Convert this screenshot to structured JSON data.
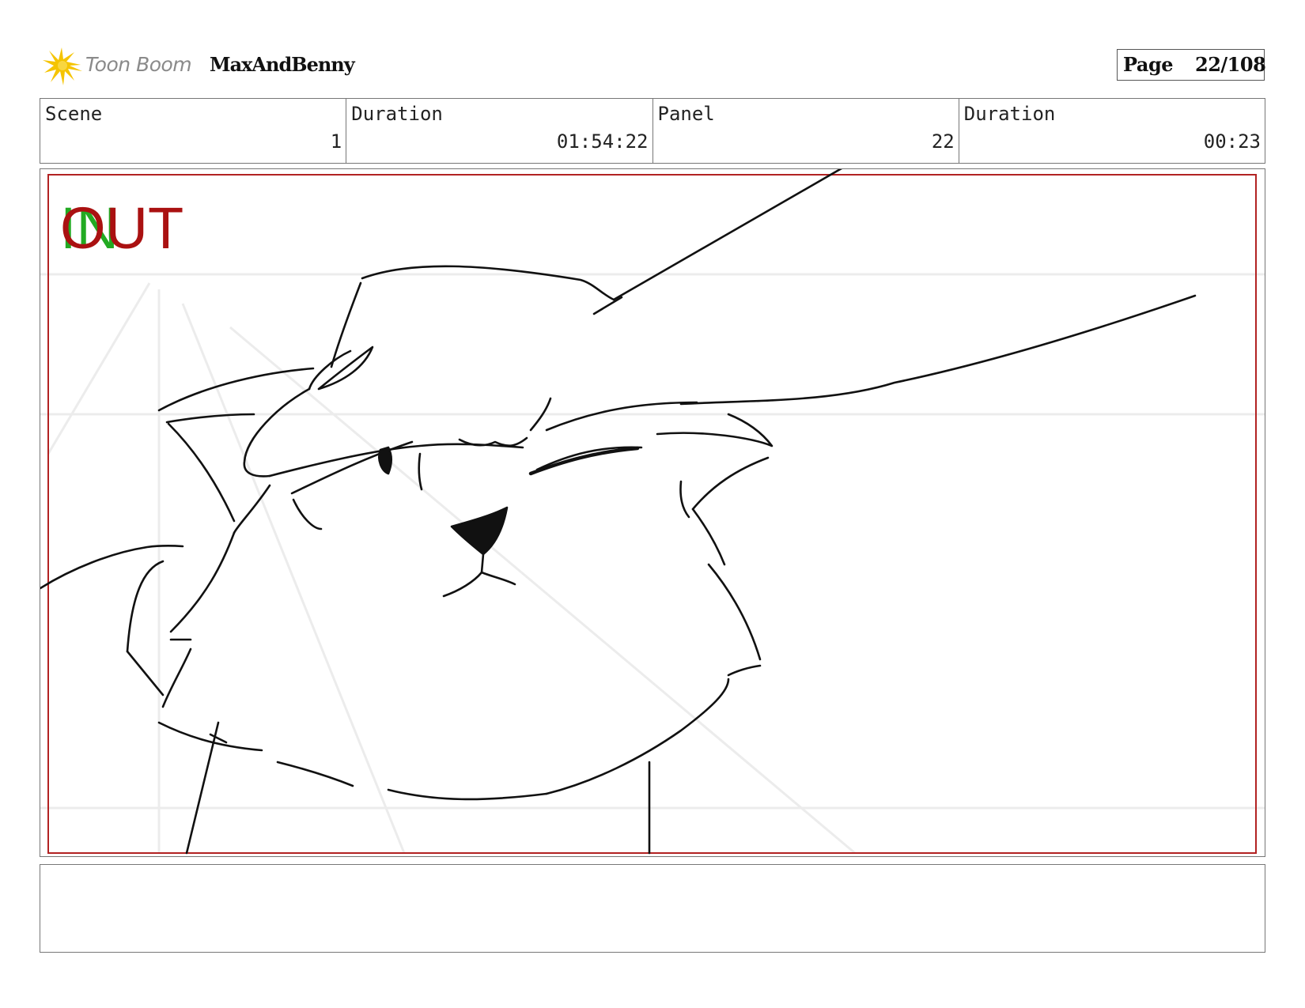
{
  "header": {
    "brand": "Toon Boom",
    "project": "MaxAndBenny",
    "page_label": "Page",
    "page_number": "22/108",
    "logo_icon": "starburst-logo-icon",
    "logo_color": "#f5c400"
  },
  "info": {
    "scene_label": "Scene",
    "scene_value": "1",
    "scene_duration_label": "Duration",
    "scene_duration_value": "01:54:22",
    "panel_label": "Panel",
    "panel_value": "22",
    "panel_duration_label": "Duration",
    "panel_duration_value": "00:23"
  },
  "panel_frame": {
    "in_label": "IN",
    "out_label": "OUT",
    "in_color": "#22aa22",
    "out_color": "#aa1111",
    "frame_color": "#b22222"
  },
  "notes": {
    "text": ""
  }
}
